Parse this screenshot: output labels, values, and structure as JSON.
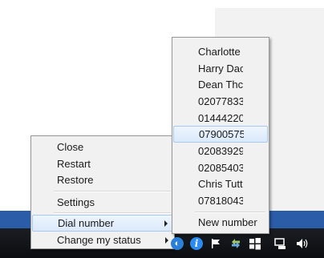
{
  "context_menu": {
    "items": [
      {
        "label": "Close"
      },
      {
        "label": "Restart"
      },
      {
        "label": "Restore"
      },
      {
        "label": "Settings"
      },
      {
        "label": "Dial number",
        "has_submenu": true,
        "highlighted": true
      },
      {
        "label": "Change my status",
        "has_submenu": true
      }
    ]
  },
  "dial_submenu": {
    "items": [
      {
        "label": "Charlotte"
      },
      {
        "label": "Harry Dac"
      },
      {
        "label": "Dean Thc"
      },
      {
        "label": "02077833"
      },
      {
        "label": "01444220"
      },
      {
        "label": "07900575",
        "highlighted": true
      },
      {
        "label": "02083929"
      },
      {
        "label": "02085403"
      },
      {
        "label": "Chris Tutt"
      },
      {
        "label": "07818043"
      }
    ],
    "new_number": "New number"
  },
  "taskbar": {
    "tray_icons": [
      "app-icon",
      "info-icon",
      "flag-icon",
      "network-sync-icon",
      "windows-icon",
      "display-icon",
      "volume-icon"
    ]
  },
  "colors": {
    "taskbar_stripe": "#2a5ca8",
    "taskbar": "#0f1115",
    "highlight": "#dbe9fb"
  }
}
